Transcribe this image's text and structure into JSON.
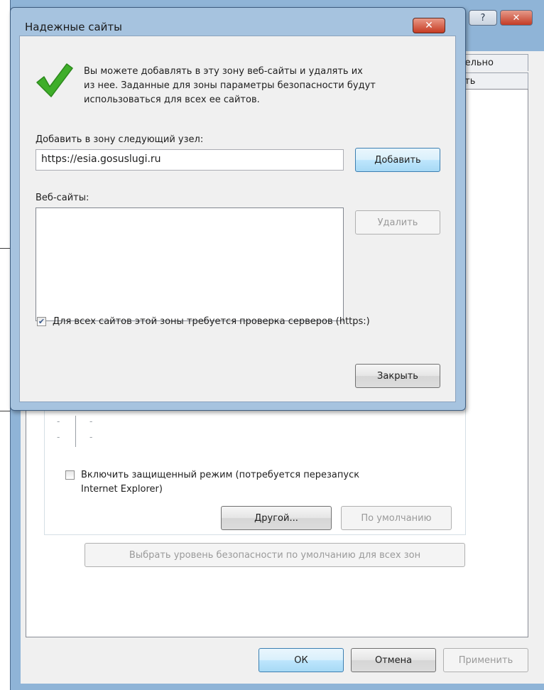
{
  "parent_window": {
    "help_label": "?",
    "close_label": "✕",
    "tabs": [
      {
        "label": "тельно"
      },
      {
        "label": "сть"
      }
    ],
    "protected_mode_label_line1": "Включить защищенный режим (потребуется перезапуск",
    "protected_mode_label_line2": "Internet Explorer)",
    "protected_mode_checked": false,
    "other_button": "Другой...",
    "default_button": "По умолчанию",
    "reset_all_zones_button": "Выбрать уровень безопасности по умолчанию для всех зон",
    "ok_button": "ОК",
    "cancel_button": "Отмена",
    "apply_button": "Применить"
  },
  "dialog": {
    "title": "Надежные сайты",
    "close_label": "✕",
    "info_line1": "Вы можете добавлять в эту зону  веб-сайты и удалять их",
    "info_line2": "из нее. Заданные для зоны параметры безопасности будут",
    "info_line3": "использоваться для всех ее сайтов.",
    "add_label": "Добавить в зону следующий узел:",
    "add_value": "https://esia.gosuslugi.ru",
    "add_button": "Добавить",
    "websites_label": "Веб-сайты:",
    "websites": [],
    "remove_button": "Удалить",
    "require_https_label": "Для всех сайтов этой зоны требуется проверка серверов (https:)",
    "require_https_checked": true,
    "close_button": "Закрыть"
  },
  "colors": {
    "frame": "#a6c3df",
    "check_green": "#3fae2a",
    "close_red": "#c63b22"
  },
  "icons": {
    "info": "checkmark-icon"
  }
}
